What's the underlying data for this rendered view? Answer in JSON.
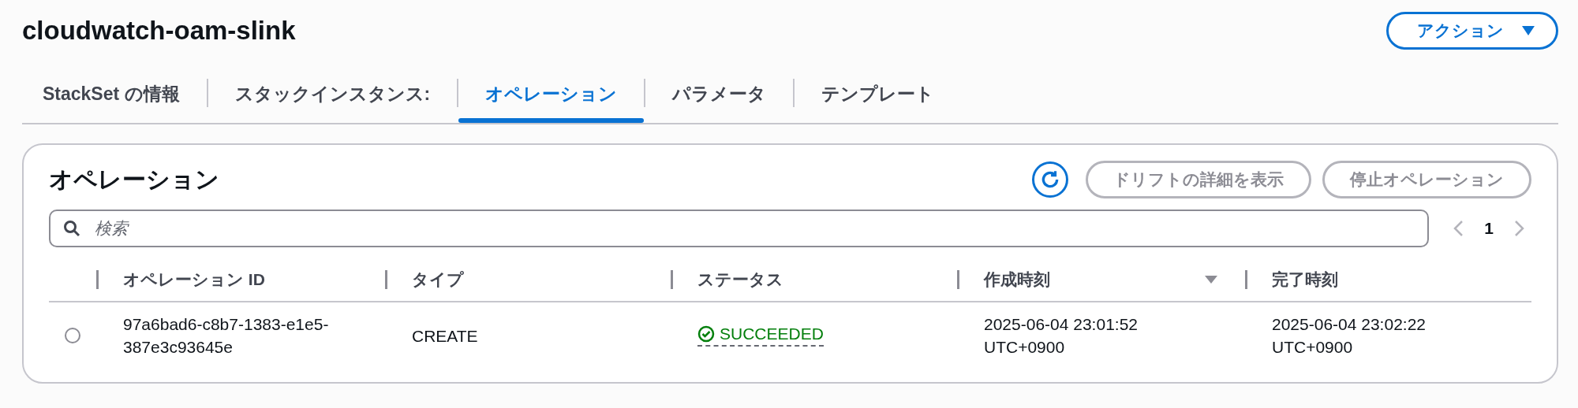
{
  "header": {
    "title": "cloudwatch-oam-slink",
    "action_button": {
      "label": "アクション",
      "disabled": false
    }
  },
  "tabs": [
    {
      "label": "StackSet の情報",
      "selected": false
    },
    {
      "label": "スタックインスタンス:",
      "selected": false
    },
    {
      "label": "オペレーション",
      "selected": true
    },
    {
      "label": "パラメータ",
      "selected": false
    },
    {
      "label": "テンプレート",
      "selected": false
    }
  ],
  "panel": {
    "title": "オペレーション",
    "buttons": [
      {
        "label": "ドリフトの詳細を表示",
        "disabled": true
      },
      {
        "label": "停止オペレーション",
        "disabled": true
      }
    ],
    "search": {
      "placeholder": "検索"
    },
    "pagination": {
      "page": "1",
      "prev_disabled": true,
      "next_disabled": true
    },
    "table": {
      "columns": [
        {
          "label": "オペレーション ID",
          "sorted": false
        },
        {
          "label": "タイプ",
          "sorted": false
        },
        {
          "label": "ステータス",
          "sorted": false
        },
        {
          "label": "作成時刻",
          "sorted": true
        },
        {
          "label": "完了時刻",
          "sorted": false
        }
      ],
      "rows": [
        {
          "selected": false,
          "id": "97a6bad6-c8b7-1383-e1e5-387e3c93645e",
          "type": "CREATE",
          "status": "SUCCEEDED",
          "created": "2025-06-04 23:01:52 UTC+0900",
          "completed": "2025-06-04 23:02:22 UTC+0900"
        }
      ]
    }
  }
}
